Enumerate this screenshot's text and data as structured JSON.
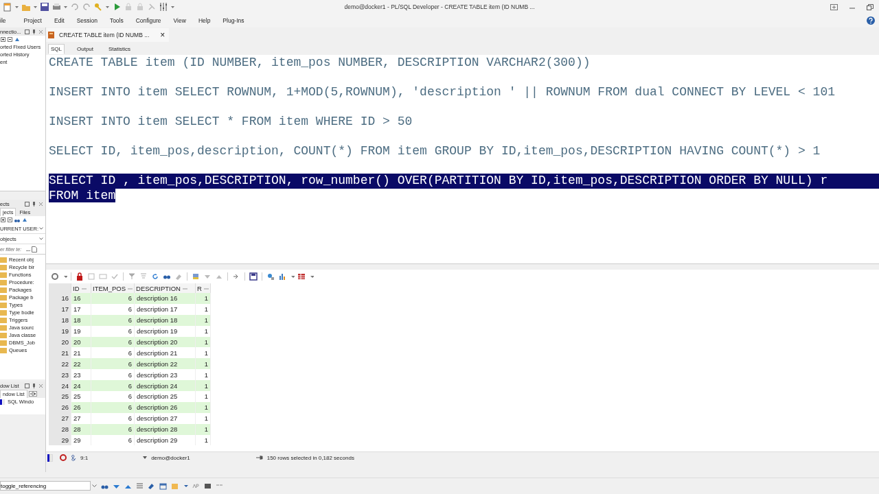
{
  "window": {
    "title": "demo@docker1 - PL/SQL Developer - CREATE TABLE item (ID NUMB ..."
  },
  "menu": [
    "ile",
    "Project",
    "Edit",
    "Session",
    "Tools",
    "Configure",
    "View",
    "Help",
    "Plug-Ins"
  ],
  "connections_panel": {
    "title": "nnectio...",
    "items": [
      "orted Fixed Users",
      "orted History",
      "ent"
    ]
  },
  "objects_panel": {
    "title": "ects",
    "tabs": [
      {
        "label": "jects",
        "selected": true
      },
      {
        "label": "Files",
        "selected": false
      }
    ],
    "user_dropdown": "URRENT USER:",
    "type_dropdown": "objects",
    "filter_placeholder": "er filter te:",
    "filter_button": "...",
    "folders": [
      "Recent obj",
      "Recycle bir",
      "Functions",
      "Procedure:",
      "Packages",
      "Package b",
      "Types",
      "Type bodie",
      "Triggers",
      "Java sourc",
      "Java classe",
      "DBMS_Job",
      "Queues"
    ]
  },
  "window_list_panel": {
    "title": "dow List",
    "tab": "ndow List",
    "items": [
      "SQL Windo"
    ]
  },
  "document_tab": {
    "title": "CREATE TABLE item (ID NUMB ...",
    "close": "×"
  },
  "subtabs": [
    {
      "label": "SQL",
      "selected": true
    },
    {
      "label": "Output",
      "selected": false
    },
    {
      "label": "Statistics",
      "selected": false
    }
  ],
  "editor": {
    "lines": [
      {
        "kind": "statement",
        "text": "CREATE TABLE item (ID NUMBER, item_pos NUMBER, DESCRIPTION VARCHAR2(300))",
        "selected": false
      },
      {
        "kind": "statement",
        "text": "INSERT INTO item SELECT ROWNUM, 1+MOD(5,ROWNUM), 'description ' || ROWNUM FROM dual CONNECT BY LEVEL < 101",
        "selected": false
      },
      {
        "kind": "statement",
        "text": "INSERT INTO item SELECT * FROM item WHERE ID > 50",
        "selected": false
      },
      {
        "kind": "statement",
        "text": "SELECT ID, item_pos,description, COUNT(*) FROM item GROUP BY ID,item_pos,DESCRIPTION HAVING COUNT(*) > 1",
        "selected": false
      },
      {
        "kind": "statement",
        "text": "SELECT ID , item_pos,DESCRIPTION, row_number() OVER(PARTITION BY ID,item_pos,DESCRIPTION ORDER BY NULL) r",
        "selected": true
      },
      {
        "kind": "continuation",
        "text": "FROM item",
        "selected": true
      }
    ]
  },
  "results": {
    "columns": [
      "ID",
      "ITEM_POS",
      "DESCRIPTION",
      "R"
    ],
    "rows": [
      {
        "num": "16",
        "cells": [
          "16",
          "6",
          "description 16",
          "1"
        ]
      },
      {
        "num": "17",
        "cells": [
          "17",
          "6",
          "description 17",
          "1"
        ]
      },
      {
        "num": "18",
        "cells": [
          "18",
          "6",
          "description 18",
          "1"
        ]
      },
      {
        "num": "19",
        "cells": [
          "19",
          "6",
          "description 19",
          "1"
        ]
      },
      {
        "num": "20",
        "cells": [
          "20",
          "6",
          "description 20",
          "1"
        ]
      },
      {
        "num": "21",
        "cells": [
          "21",
          "6",
          "description 21",
          "1"
        ]
      },
      {
        "num": "22",
        "cells": [
          "22",
          "6",
          "description 22",
          "1"
        ]
      },
      {
        "num": "23",
        "cells": [
          "23",
          "6",
          "description 23",
          "1"
        ]
      },
      {
        "num": "24",
        "cells": [
          "24",
          "6",
          "description 24",
          "1"
        ]
      },
      {
        "num": "25",
        "cells": [
          "25",
          "6",
          "description 25",
          "1"
        ]
      },
      {
        "num": "26",
        "cells": [
          "26",
          "6",
          "description 26",
          "1"
        ]
      },
      {
        "num": "27",
        "cells": [
          "27",
          "6",
          "description 27",
          "1"
        ]
      },
      {
        "num": "28",
        "cells": [
          "28",
          "6",
          "description 28",
          "1"
        ]
      },
      {
        "num": "29",
        "cells": [
          "29",
          "6",
          "description 29",
          "1"
        ]
      }
    ]
  },
  "status_bar": {
    "position": "9:1",
    "connection": "demo@docker1",
    "message": "150 rows selected in 0,182 seconds"
  },
  "find_bar": {
    "value": "toggle_referencing"
  }
}
